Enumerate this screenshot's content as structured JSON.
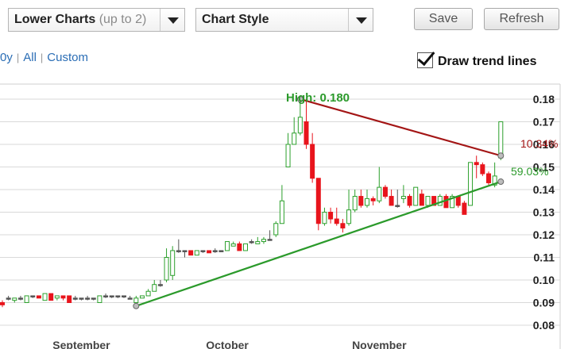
{
  "controls": {
    "lower_charts_label": "Lower Charts",
    "lower_charts_hint": "(up to 2)",
    "chart_style_label": "Chart Style",
    "save_label": "Save",
    "refresh_label": "Refresh"
  },
  "ranges": [
    {
      "label": "0y"
    },
    {
      "label": "All"
    },
    {
      "label": "Custom"
    }
  ],
  "trend_lines": {
    "label": "Draw trend lines",
    "checked": true
  },
  "colors": {
    "up": "#2ca02c",
    "down": "#e8141c",
    "neutral": "#555555",
    "resistance": "#a31515",
    "support": "#2b9a2b",
    "high_label": "#2b9a2b",
    "grid": "#d9d9d9"
  },
  "chart_data": {
    "type": "candlestick",
    "annotations": {
      "high": "High: 0.180",
      "upper_pct": "10.34%",
      "lower_pct": "59.03%"
    },
    "x_labels": [
      {
        "label": "September",
        "x_index": 13
      },
      {
        "label": "October",
        "x_index": 37
      },
      {
        "label": "November",
        "x_index": 62
      }
    ],
    "y_ticks": [
      "0.18",
      "0.17",
      "0.16",
      "0.15",
      "0.14",
      "0.13",
      "0.12",
      "0.11",
      "0.10",
      "0.09",
      "0.08"
    ],
    "ylim": [
      0.08,
      0.18
    ],
    "trend_lines": [
      {
        "name": "resistance",
        "from": {
          "x_index": 49,
          "y": 0.18
        },
        "to": {
          "x_index": 82,
          "y": 0.155
        }
      },
      {
        "name": "support",
        "from": {
          "x_index": 22,
          "y": 0.0885
        },
        "to": {
          "x_index": 82,
          "y": 0.1435
        }
      }
    ],
    "candles": [
      [
        0.09,
        0.089,
        0.091,
        0.088
      ],
      [
        0.092,
        0.092,
        0.093,
        0.091
      ],
      [
        0.091,
        0.092,
        0.092,
        0.09
      ],
      [
        0.092,
        0.092,
        0.093,
        0.091
      ],
      [
        0.09,
        0.093,
        0.093,
        0.09
      ],
      [
        0.093,
        0.093,
        0.093,
        0.092
      ],
      [
        0.093,
        0.092,
        0.093,
        0.092
      ],
      [
        0.091,
        0.094,
        0.094,
        0.091
      ],
      [
        0.094,
        0.091,
        0.094,
        0.091
      ],
      [
        0.092,
        0.093,
        0.093,
        0.091
      ],
      [
        0.093,
        0.092,
        0.093,
        0.091
      ],
      [
        0.093,
        0.09,
        0.093,
        0.09
      ],
      [
        0.092,
        0.092,
        0.093,
        0.091
      ],
      [
        0.092,
        0.092,
        0.092,
        0.091
      ],
      [
        0.092,
        0.092,
        0.093,
        0.091
      ],
      [
        0.092,
        0.092,
        0.092,
        0.091
      ],
      [
        0.09,
        0.093,
        0.093,
        0.09
      ],
      [
        0.093,
        0.093,
        0.094,
        0.092
      ],
      [
        0.093,
        0.093,
        0.093,
        0.092
      ],
      [
        0.093,
        0.093,
        0.093,
        0.092
      ],
      [
        0.093,
        0.093,
        0.093,
        0.092
      ],
      [
        0.092,
        0.092,
        0.093,
        0.092
      ],
      [
        0.09,
        0.092,
        0.093,
        0.089
      ],
      [
        0.092,
        0.093,
        0.093,
        0.092
      ],
      [
        0.093,
        0.095,
        0.096,
        0.093
      ],
      [
        0.095,
        0.098,
        0.1,
        0.095
      ],
      [
        0.098,
        0.098,
        0.1,
        0.097
      ],
      [
        0.1,
        0.11,
        0.114,
        0.099
      ],
      [
        0.102,
        0.113,
        0.115,
        0.1
      ],
      [
        0.113,
        0.113,
        0.118,
        0.112
      ],
      [
        0.113,
        0.113,
        0.113,
        0.11
      ],
      [
        0.113,
        0.111,
        0.113,
        0.111
      ],
      [
        0.111,
        0.113,
        0.113,
        0.111
      ],
      [
        0.113,
        0.113,
        0.113,
        0.112
      ],
      [
        0.113,
        0.112,
        0.113,
        0.112
      ],
      [
        0.113,
        0.113,
        0.114,
        0.112
      ],
      [
        0.113,
        0.113,
        0.113,
        0.113
      ],
      [
        0.113,
        0.117,
        0.117,
        0.113
      ],
      [
        0.115,
        0.116,
        0.117,
        0.115
      ],
      [
        0.116,
        0.113,
        0.117,
        0.113
      ],
      [
        0.113,
        0.116,
        0.116,
        0.113
      ],
      [
        0.117,
        0.117,
        0.118,
        0.116
      ],
      [
        0.116,
        0.117,
        0.119,
        0.116
      ],
      [
        0.117,
        0.118,
        0.119,
        0.116
      ],
      [
        0.118,
        0.118,
        0.122,
        0.118
      ],
      [
        0.12,
        0.125,
        0.126,
        0.119
      ],
      [
        0.125,
        0.135,
        0.142,
        0.125
      ],
      [
        0.15,
        0.16,
        0.165,
        0.15
      ],
      [
        0.16,
        0.165,
        0.172,
        0.16
      ],
      [
        0.165,
        0.172,
        0.18,
        0.164
      ],
      [
        0.17,
        0.16,
        0.18,
        0.158
      ],
      [
        0.16,
        0.145,
        0.165,
        0.143
      ],
      [
        0.145,
        0.125,
        0.145,
        0.122
      ],
      [
        0.125,
        0.13,
        0.132,
        0.124
      ],
      [
        0.13,
        0.127,
        0.132,
        0.125
      ],
      [
        0.127,
        0.125,
        0.132,
        0.124
      ],
      [
        0.125,
        0.123,
        0.127,
        0.121
      ],
      [
        0.125,
        0.131,
        0.14,
        0.124
      ],
      [
        0.131,
        0.137,
        0.14,
        0.13
      ],
      [
        0.137,
        0.133,
        0.14,
        0.132
      ],
      [
        0.133,
        0.136,
        0.14,
        0.132
      ],
      [
        0.136,
        0.135,
        0.137,
        0.133
      ],
      [
        0.135,
        0.141,
        0.15,
        0.134
      ],
      [
        0.141,
        0.137,
        0.142,
        0.136
      ],
      [
        0.137,
        0.133,
        0.14,
        0.133
      ],
      [
        0.133,
        0.133,
        0.14,
        0.132
      ],
      [
        0.136,
        0.137,
        0.142,
        0.134
      ],
      [
        0.137,
        0.133,
        0.138,
        0.132
      ],
      [
        0.133,
        0.141,
        0.141,
        0.133
      ],
      [
        0.138,
        0.133,
        0.14,
        0.133
      ],
      [
        0.133,
        0.137,
        0.137,
        0.132
      ],
      [
        0.137,
        0.133,
        0.137,
        0.133
      ],
      [
        0.133,
        0.137,
        0.138,
        0.133
      ],
      [
        0.137,
        0.132,
        0.138,
        0.132
      ],
      [
        0.132,
        0.137,
        0.138,
        0.132
      ],
      [
        0.137,
        0.133,
        0.137,
        0.132
      ],
      [
        0.134,
        0.129,
        0.135,
        0.129
      ],
      [
        0.133,
        0.152,
        0.152,
        0.133
      ],
      [
        0.152,
        0.151,
        0.155,
        0.145
      ],
      [
        0.151,
        0.147,
        0.152,
        0.146
      ],
      [
        0.147,
        0.143,
        0.148,
        0.142
      ],
      [
        0.142,
        0.146,
        0.152,
        0.141
      ],
      [
        0.154,
        0.17,
        0.17,
        0.153
      ]
    ]
  }
}
